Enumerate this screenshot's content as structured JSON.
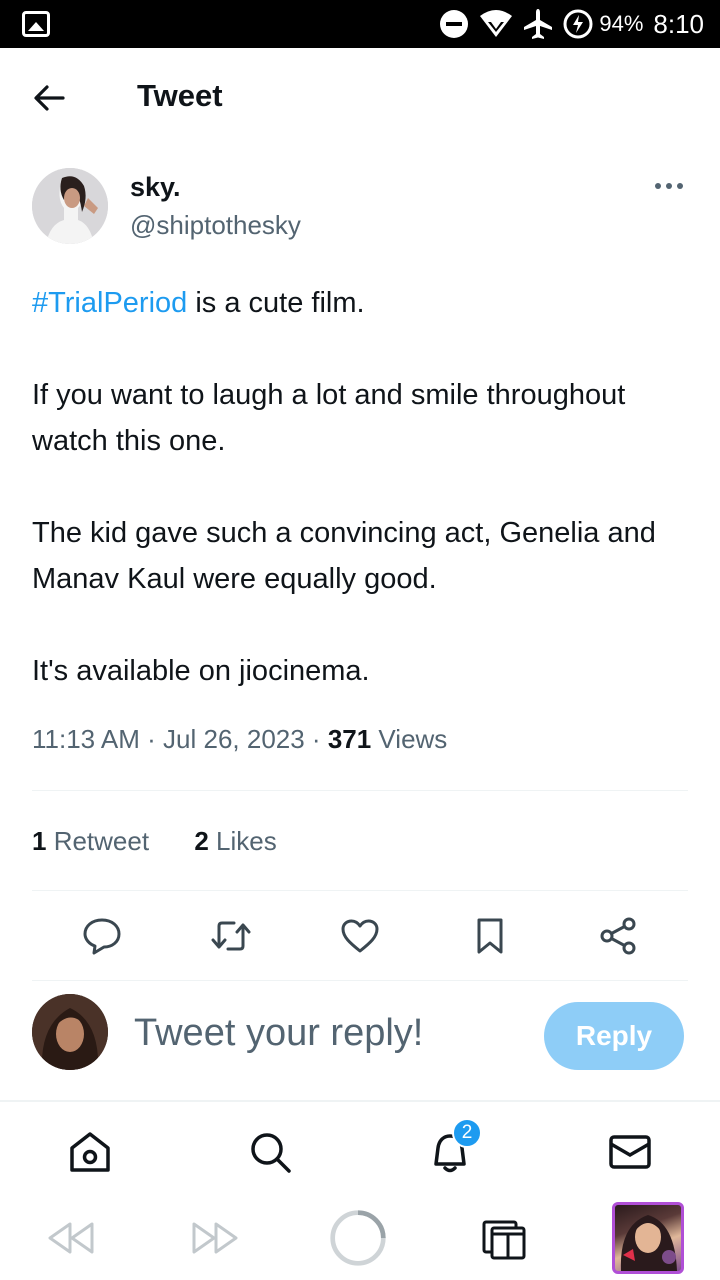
{
  "status_bar": {
    "battery_percent": "94%",
    "time": "8:10",
    "icons": [
      "gallery-icon",
      "do-not-disturb-icon",
      "wifi-icon",
      "airplane-mode-icon",
      "battery-charging-icon"
    ]
  },
  "header": {
    "title": "Tweet",
    "back_icon": "arrow-left-icon"
  },
  "tweet": {
    "author_name": "sky.",
    "author_handle": "@shiptothesky",
    "hashtag": "#TrialPeriod",
    "text_first_line_rest": " is a cute film.",
    "paragraph_2": "If you want to laugh a lot and smile throughout watch this one.",
    "paragraph_3": "The kid gave such a convincing act, Genelia and Manav Kaul were equally good.",
    "paragraph_4": "It's available on jiocinema.",
    "timestamp": "11:13 AM · Jul 26, 2023 · ",
    "views_count": "371",
    "views_label": " Views"
  },
  "stats": {
    "retweets_count": "1",
    "retweets_label": " Retweet",
    "likes_count": "2",
    "likes_label": " Likes"
  },
  "actions": [
    "reply-icon",
    "retweet-icon",
    "like-icon",
    "bookmark-icon",
    "share-icon"
  ],
  "reply": {
    "placeholder": "Tweet your reply!",
    "button_label": "Reply"
  },
  "tabbar": {
    "notifications_badge": "2",
    "icons": [
      "home-icon",
      "search-icon",
      "notifications-icon",
      "messages-icon"
    ]
  },
  "browser_bar": {
    "icons": [
      "rewind-icon",
      "fast-forward-icon",
      "loading-icon",
      "tabs-icon"
    ]
  },
  "colors": {
    "accent": "#1d9bf0",
    "reply_button": "#8ecdf7",
    "secondary_text": "#536471"
  }
}
